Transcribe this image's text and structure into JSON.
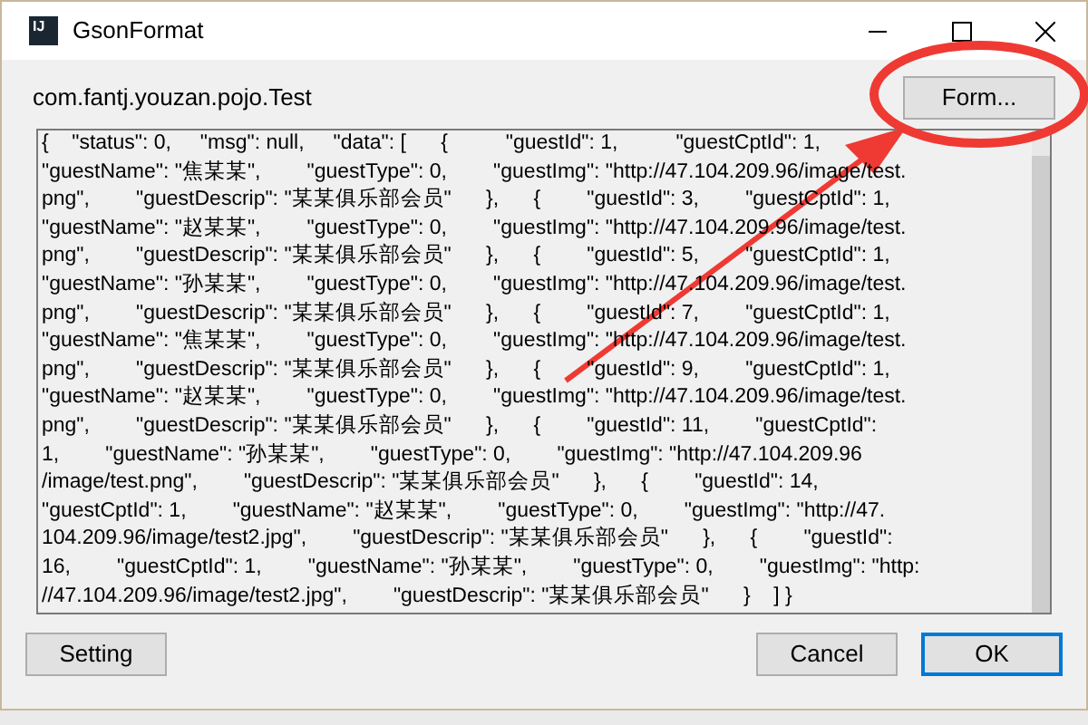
{
  "window": {
    "title": "GsonFormat",
    "app_icon": "IJ"
  },
  "class_name": "com.fantj.youzan.pojo.Test",
  "format_button": "Form...",
  "json_lines": [
    "{    \"status\": 0,     \"msg\": null,     \"data\": [      {          \"guestId\": 1,          \"guestCptId\": 1,",
    "\"guestName\": \"焦某某\",        \"guestType\": 0,        \"guestImg\": \"http://47.104.209.96/image/test.",
    "png\",        \"guestDescrip\": \"某某俱乐部会员\"      },      {        \"guestId\": 3,        \"guestCptId\": 1,",
    "\"guestName\": \"赵某某\",        \"guestType\": 0,        \"guestImg\": \"http://47.104.209.96/image/test.",
    "png\",        \"guestDescrip\": \"某某俱乐部会员\"      },      {        \"guestId\": 5,        \"guestCptId\": 1,",
    "\"guestName\": \"孙某某\",        \"guestType\": 0,        \"guestImg\": \"http://47.104.209.96/image/test.",
    "png\",        \"guestDescrip\": \"某某俱乐部会员\"      },      {        \"guestId\": 7,        \"guestCptId\": 1,",
    "\"guestName\": \"焦某某\",        \"guestType\": 0,        \"guestImg\": \"http://47.104.209.96/image/test.",
    "png\",        \"guestDescrip\": \"某某俱乐部会员\"      },      {        \"guestId\": 9,        \"guestCptId\": 1,",
    "\"guestName\": \"赵某某\",        \"guestType\": 0,        \"guestImg\": \"http://47.104.209.96/image/test.",
    "png\",        \"guestDescrip\": \"某某俱乐部会员\"      },      {        \"guestId\": 11,        \"guestCptId\":",
    "1,        \"guestName\": \"孙某某\",        \"guestType\": 0,        \"guestImg\": \"http://47.104.209.96",
    "/image/test.png\",        \"guestDescrip\": \"某某俱乐部会员\"      },      {        \"guestId\": 14,",
    "\"guestCptId\": 1,        \"guestName\": \"赵某某\",        \"guestType\": 0,        \"guestImg\": \"http://47.",
    "104.209.96/image/test2.jpg\",        \"guestDescrip\": \"某某俱乐部会员\"      },      {        \"guestId\":",
    "16,        \"guestCptId\": 1,        \"guestName\": \"孙某某\",        \"guestType\": 0,        \"guestImg\": \"http:",
    "//47.104.209.96/image/test2.jpg\",        \"guestDescrip\": \"某某俱乐部会员\"      }    ] }"
  ],
  "left_buttons": [
    {
      "label": "Setting",
      "default": false
    }
  ],
  "right_buttons": [
    {
      "label": "Cancel",
      "default": false
    },
    {
      "label": "OK",
      "default": true
    }
  ]
}
